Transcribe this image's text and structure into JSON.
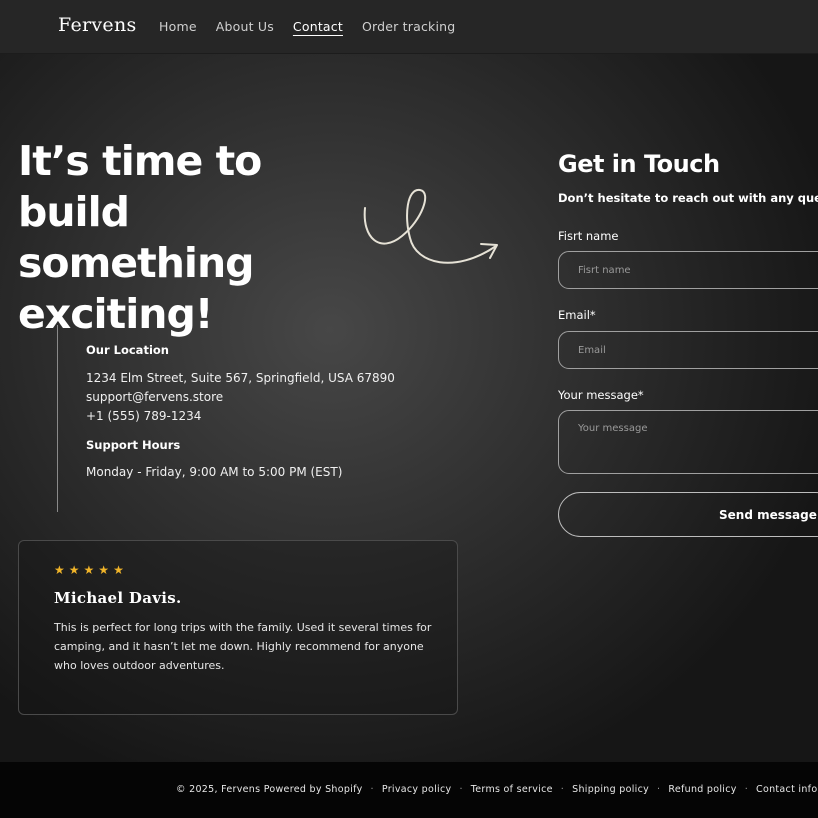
{
  "header": {
    "logo": "Fervens",
    "nav": [
      {
        "label": "Home"
      },
      {
        "label": "About Us"
      },
      {
        "label": "Contact"
      },
      {
        "label": "Order tracking"
      }
    ]
  },
  "hero": {
    "title": "It’s time to build something exciting!"
  },
  "info": {
    "location_heading": "Our Location",
    "address": "1234 Elm Street, Suite 567, Springfield, USA 67890",
    "email": "support@fervens.store",
    "phone": "+1 (555) 789-1234",
    "hours_heading": "Support Hours",
    "hours": "Monday - Friday, 9:00 AM to 5:00 PM (EST)"
  },
  "review": {
    "stars": 5,
    "name": "Michael Davis.",
    "text": "This is perfect for long trips with the family. Used it several times for camping, and it hasn’t let me down. Highly recommend for anyone who loves outdoor adventures."
  },
  "form": {
    "title": "Get in Touch",
    "subtitle": "Don’t hesitate to reach out with any questions",
    "first_name_label": "Fisrt name",
    "first_name_placeholder": "Fisrt name",
    "email_label": "Email*",
    "email_placeholder": "Email",
    "message_label": "Your message*",
    "message_placeholder": "Your message",
    "send_label": "Send message"
  },
  "footer": {
    "copyright": "© 2025, Fervens Powered by Shopify",
    "links": [
      {
        "label": "Privacy policy"
      },
      {
        "label": "Terms of service"
      },
      {
        "label": "Shipping policy"
      },
      {
        "label": "Refund policy"
      },
      {
        "label": "Contact information"
      }
    ]
  },
  "colors": {
    "star": "#f0b429",
    "footer_bg": "#050505",
    "header_bg": "#262626"
  }
}
